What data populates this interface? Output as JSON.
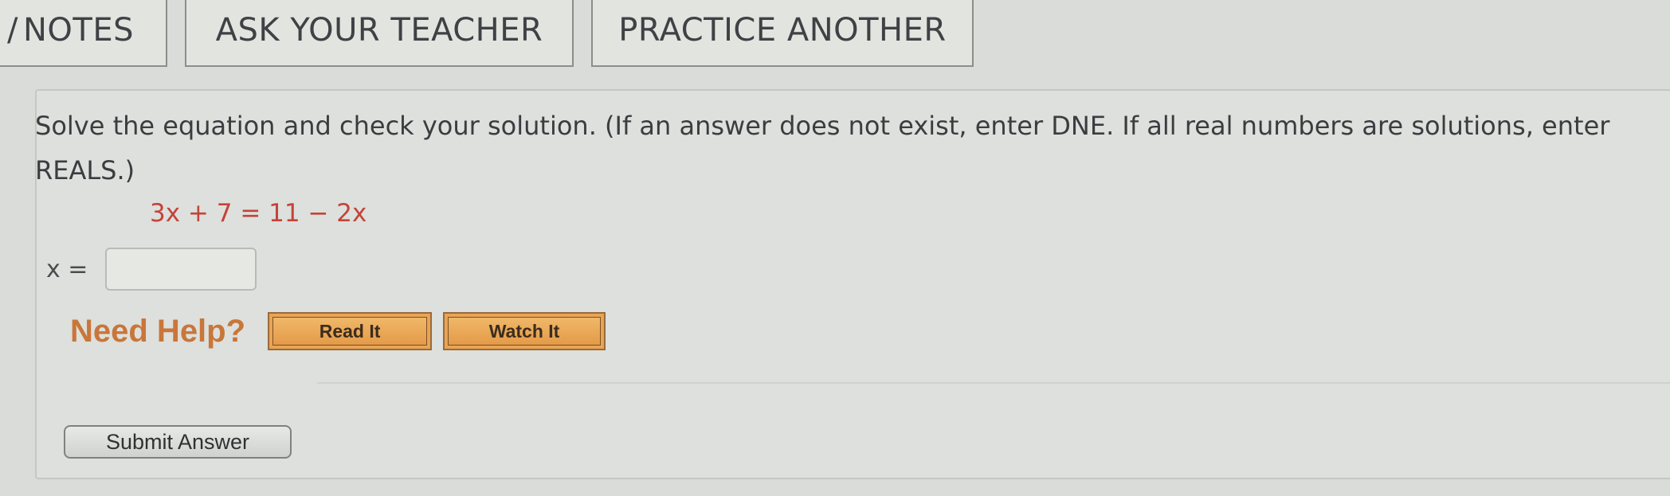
{
  "tabs": {
    "notes_mark": "/",
    "notes": "NOTES",
    "ask": "ASK YOUR TEACHER",
    "practice": "PRACTICE ANOTHER"
  },
  "question": {
    "prompt": "Solve the equation and check your solution. (If an answer does not exist, enter DNE. If all real numbers are solutions, enter REALS.)",
    "equation": "3x + 7 = 11 − 2x",
    "answer_label": "x =",
    "answer_value": ""
  },
  "help": {
    "label": "Need Help?",
    "read_it": "Read It",
    "watch_it": "Watch It"
  },
  "submit": {
    "label": "Submit Answer"
  },
  "colors": {
    "equation": "#c4433a",
    "need_help": "#c9763a",
    "help_button": "#e8a456"
  }
}
